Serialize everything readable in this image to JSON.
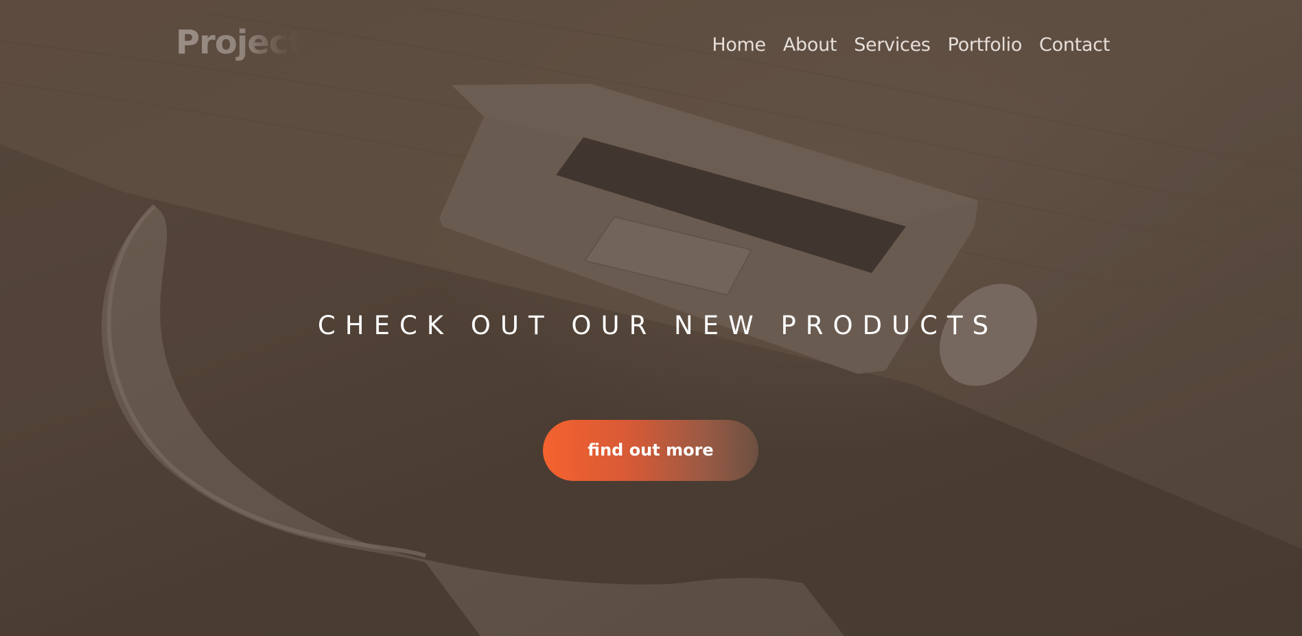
{
  "header": {
    "logo_text": "Project",
    "nav": [
      {
        "label": "Home"
      },
      {
        "label": "About"
      },
      {
        "label": "Services"
      },
      {
        "label": "Portfolio"
      },
      {
        "label": "Contact"
      }
    ]
  },
  "hero": {
    "headline": "CHECK OUT OUR NEW PRODUCTS",
    "cta_label": "find out more",
    "background_image": "laptop-and-mouse-on-wooden-desk",
    "cta_color": "#f5622f"
  }
}
